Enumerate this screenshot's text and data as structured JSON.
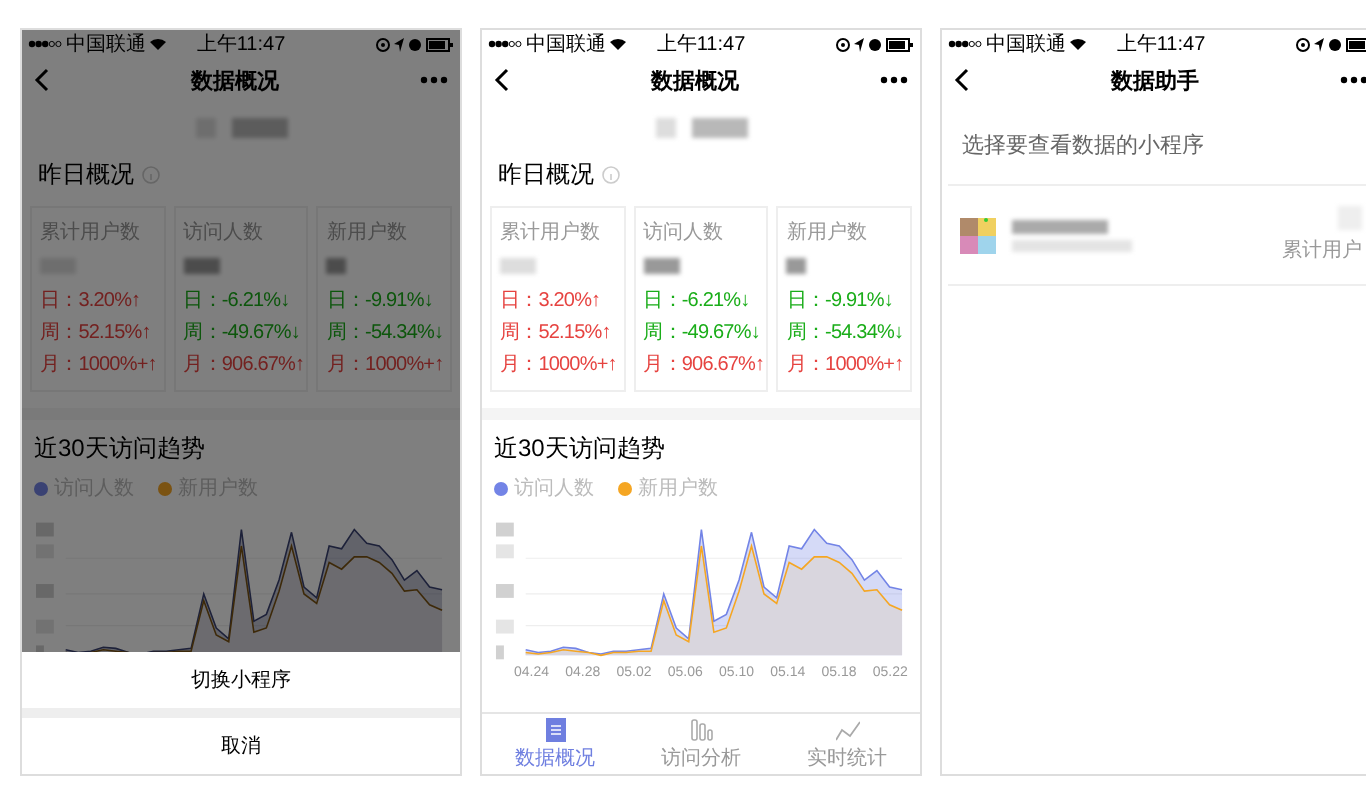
{
  "screens": [
    {
      "kind": "overview",
      "dimmed": true,
      "status_bar": {
        "carrier": "中国联通",
        "time": "上午11:47"
      },
      "nav": {
        "title": "数据概况"
      },
      "section_title": "昨日概况",
      "cards": [
        {
          "label": "累计用户数",
          "stats": [
            {
              "text": "日：3.20%↑",
              "kind": "up"
            },
            {
              "text": "周：52.15%↑",
              "kind": "up"
            },
            {
              "text": "月：1000%+↑",
              "kind": "up"
            }
          ]
        },
        {
          "label": "访问人数",
          "stats": [
            {
              "text": "日：-6.21%↓",
              "kind": "down"
            },
            {
              "text": "周：-49.67%↓",
              "kind": "down"
            },
            {
              "text": "月：906.67%↑",
              "kind": "up"
            }
          ]
        },
        {
          "label": "新用户数",
          "stats": [
            {
              "text": "日：-9.91%↓",
              "kind": "down"
            },
            {
              "text": "周：-54.34%↓",
              "kind": "down"
            },
            {
              "text": "月：1000%+↑",
              "kind": "up"
            }
          ]
        }
      ],
      "trend": {
        "title": "近30天访问趋势",
        "legend": [
          {
            "label": "访问人数",
            "color": "#3a4273"
          },
          {
            "label": "新用户数",
            "color": "#7b5312"
          }
        ]
      },
      "action_sheet": {
        "options": [
          "切换小程序"
        ],
        "cancel": "取消"
      }
    },
    {
      "kind": "overview",
      "dimmed": false,
      "status_bar": {
        "carrier": "中国联通",
        "time": "上午11:47"
      },
      "nav": {
        "title": "数据概况"
      },
      "section_title": "昨日概况",
      "cards": [
        {
          "label": "累计用户数",
          "stats": [
            {
              "text": "日：3.20%↑",
              "kind": "up"
            },
            {
              "text": "周：52.15%↑",
              "kind": "up"
            },
            {
              "text": "月：1000%+↑",
              "kind": "up"
            }
          ]
        },
        {
          "label": "访问人数",
          "stats": [
            {
              "text": "日：-6.21%↓",
              "kind": "down"
            },
            {
              "text": "周：-49.67%↓",
              "kind": "down"
            },
            {
              "text": "月：906.67%↑",
              "kind": "up"
            }
          ]
        },
        {
          "label": "新用户数",
          "stats": [
            {
              "text": "日：-9.91%↓",
              "kind": "down"
            },
            {
              "text": "周：-54.34%↓",
              "kind": "down"
            },
            {
              "text": "月：1000%+↑",
              "kind": "up"
            }
          ]
        }
      ],
      "trend": {
        "title": "近30天访问趋势",
        "legend": [
          {
            "label": "访问人数",
            "color": "#7384e6"
          },
          {
            "label": "新用户数",
            "color": "#f5a623"
          }
        ],
        "x_labels": [
          "04.24",
          "04.28",
          "05.02",
          "05.06",
          "05.10",
          "05.14",
          "05.18",
          "05.22"
        ]
      },
      "tab_bar": [
        {
          "kind": "list",
          "label": "数据概况",
          "selected": true
        },
        {
          "kind": "bars",
          "label": "访问分析",
          "selected": false
        },
        {
          "kind": "line",
          "label": "实时统计",
          "selected": false
        }
      ]
    },
    {
      "kind": "picker",
      "status_bar": {
        "carrier": "中国联通",
        "time": "上午11:47"
      },
      "nav": {
        "title": "数据助手"
      },
      "prompt": "选择要查看数据的小程序",
      "item": {
        "caption": "累计用户"
      }
    }
  ]
}
